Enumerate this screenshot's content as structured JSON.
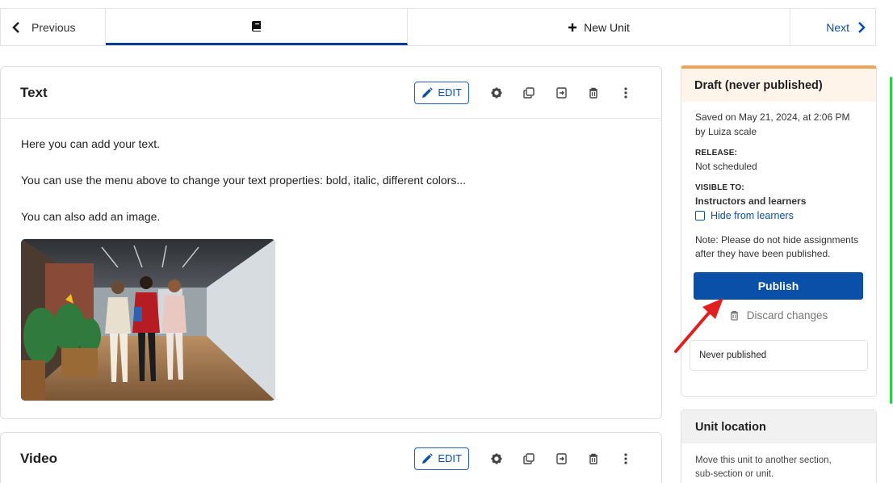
{
  "nav": {
    "prev_label": "Previous",
    "new_unit_label": "New Unit",
    "next_label": "Next"
  },
  "blocks": [
    {
      "title": "Text",
      "edit_label": "EDIT",
      "paragraphs": [
        "Here you can add your text.",
        "You can use the menu above to change your text properties: bold, italic, different colors...",
        "You can also add an image."
      ]
    },
    {
      "title": "Video",
      "edit_label": "EDIT"
    }
  ],
  "status": {
    "title": "Draft (never published)",
    "saved_line1": "Saved on May 21, 2024, at 2:06 PM",
    "saved_line2": "by Luiza scale",
    "release_label": "RELEASE:",
    "release_value": "Not scheduled",
    "visible_label": "VISIBLE TO:",
    "visible_value": "Instructors and learners",
    "hide_label": "Hide from learners",
    "hide_checked": false,
    "note_line1": "Note: Please do not hide assignments",
    "note_line2": "after they have been published.",
    "publish_label": "Publish",
    "discard_label": "Discard changes",
    "never_published": "Never published"
  },
  "location": {
    "title": "Unit location",
    "desc_line1": "Move this unit to another section,",
    "desc_line2": "sub-section or unit."
  },
  "colors": {
    "primary": "#0a4fa8",
    "draft_accent": "#f0a35b",
    "annotation_arrow": "#e02020",
    "scrollbar": "#2ecc40"
  }
}
